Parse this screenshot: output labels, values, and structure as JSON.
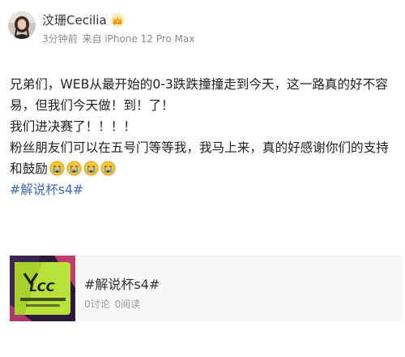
{
  "author": {
    "name": "汶珊Cecilia",
    "badge_icon": "crown-icon"
  },
  "meta": {
    "time": "3分钟前",
    "source": "来自 iPhone 12 Pro Max"
  },
  "post": {
    "line1": "兄弟们，WEB从最开始的0-3跌跌撞撞走到今天，这一路真的好不容易，但我们今天做！到！了！",
    "line2": "我们进决赛了！！！！",
    "line3": "粉丝朋友们可以在五号门等等我，我马上来，真的好感谢你们的支持和鼓励",
    "emoji_icons": [
      "crying-face-icon",
      "crying-face-icon",
      "crying-face-icon",
      "crying-face-icon"
    ],
    "hashtag": "#解说杯s4#"
  },
  "topic_card": {
    "title": "#解说杯s4#",
    "discussions": "0讨论",
    "reads": "0阅读",
    "thumbnail_text": "LCC",
    "colors": {
      "thumb_bg": "#2b1a3a",
      "thumb_accent": "#b8e23a",
      "thumb_pink": "#e0427a"
    }
  },
  "colors": {
    "link": "#3e6aaf",
    "meta_text": "#8a8a8a",
    "card_bg": "#f7f7f7"
  }
}
